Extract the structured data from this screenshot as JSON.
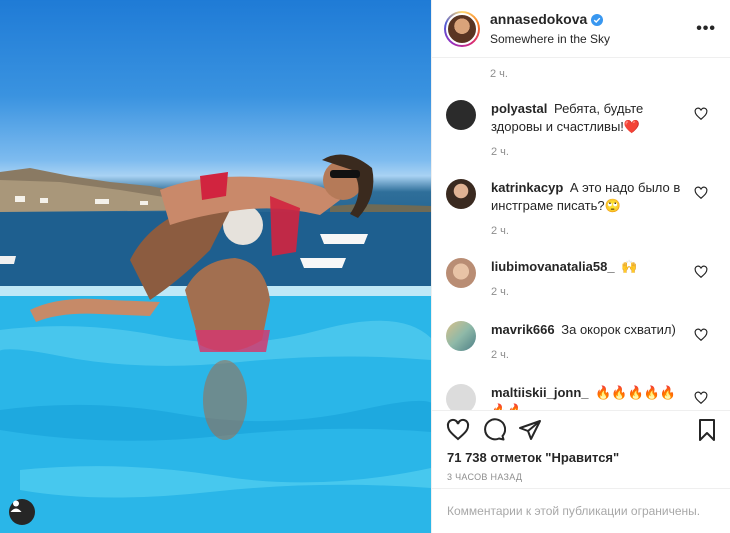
{
  "post": {
    "author": "annasedokova",
    "location": "Somewhere in the Sky",
    "top_time": "2 ч."
  },
  "comments": [
    {
      "user": "polyastal",
      "text": "Ребята, будьте здоровы и счастливы!❤️",
      "time": "2 ч.",
      "avatar_color": "#2b2b2b"
    },
    {
      "user": "katrinkacyp",
      "text": "А это надо было в инстграме писать?🙄",
      "time": "2 ч.",
      "avatar_color": "#3a2a20"
    },
    {
      "user": "liubimovanatalia58_",
      "text": "🙌",
      "time": "2 ч.",
      "avatar_color": "#c9a48a"
    },
    {
      "user": "mavrik666",
      "text": "За окорок схватил)",
      "time": "2 ч.",
      "avatar_color": "#8fb9a8"
    },
    {
      "user": "maltiiskii_jonn_",
      "text": "🔥🔥🔥🔥🔥🔥🔥",
      "time": "",
      "avatar_color": "#dcdcdc"
    }
  ],
  "stats": {
    "likes": "71 738 отметок \"Нравится\"",
    "posted": "3 ЧАСОВ НАЗАД"
  },
  "footer": {
    "comments_closed": "Комментарии к этой публикации ограничены."
  },
  "icons": {
    "more": "more-dots-icon",
    "like": "heart-icon",
    "comment": "comment-icon",
    "share": "paper-plane-icon",
    "save": "bookmark-icon",
    "user_tag": "user-tag-icon",
    "verified": "verified-badge-icon"
  },
  "colors": {
    "verified": "#3897f0",
    "secondary_text": "#8e8e8e",
    "divider": "#efefef"
  }
}
